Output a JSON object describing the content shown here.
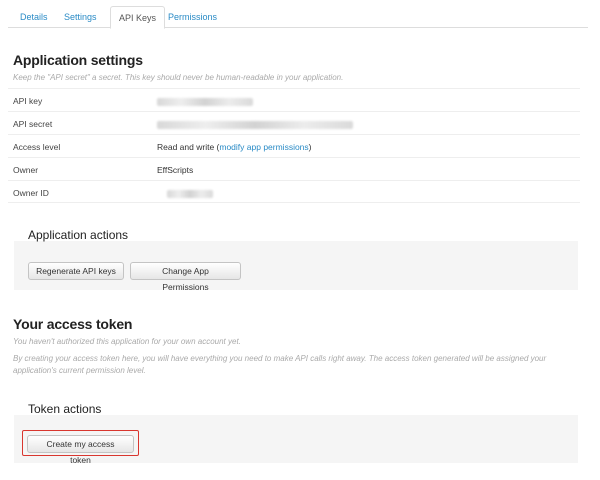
{
  "tabs": [
    {
      "label": "Details"
    },
    {
      "label": "Settings"
    },
    {
      "label": "API Keys"
    },
    {
      "label": "Permissions"
    }
  ],
  "app_settings": {
    "title": "Application settings",
    "note": "Keep the \"API secret\" a secret. This key should never be human-readable in your application.",
    "rows": [
      {
        "label": "API key"
      },
      {
        "label": "API secret"
      },
      {
        "label": "Access level",
        "value_prefix": "Read and write (",
        "link": "modify app permissions",
        "value_suffix": ")"
      },
      {
        "label": "Owner",
        "value": "EffScripts"
      },
      {
        "label": "Owner ID"
      }
    ]
  },
  "app_actions": {
    "title": "Application actions",
    "regenerate_label": "Regenerate API keys",
    "change_perms_label": "Change App Permissions"
  },
  "access_token": {
    "title": "Your access token",
    "note1": "You haven't authorized this application for your own account yet.",
    "note2": "By creating your access token here, you will have everything you need to make API calls right away. The access token generated will be assigned your application's current permission level."
  },
  "token_actions": {
    "title": "Token actions",
    "create_label": "Create my access token"
  },
  "colors": {
    "link": "#2a8bc6",
    "highlight": "#d9362f",
    "panel_bg": "#f5f5f5"
  }
}
